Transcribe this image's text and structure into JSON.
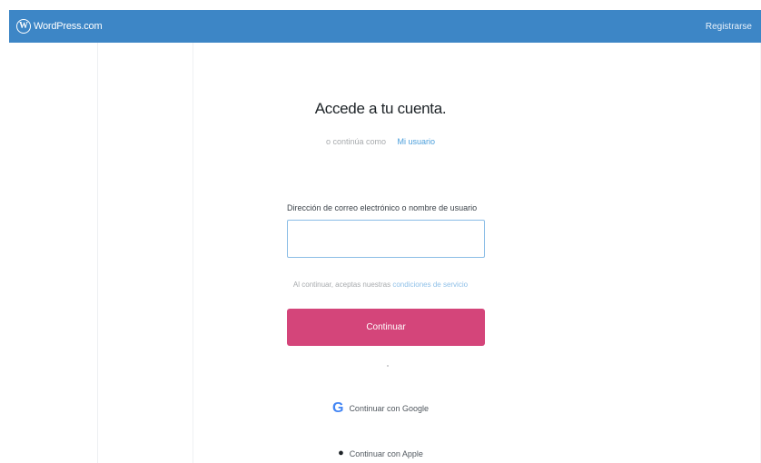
{
  "header": {
    "brand": "WordPress.com",
    "logo_letter": "W",
    "signup_link": "Registrarse"
  },
  "login": {
    "title": "Accede a tu cuenta.",
    "continue_as_prefix": "o continúa como",
    "continue_as_user": "Mi usuario",
    "email_label": "Dirección de correo electrónico o nombre de usuario",
    "email_value": "",
    "tos_prefix": "Al continuar, aceptas nuestras",
    "tos_link": "condiciones de servicio",
    "continue_button": "Continuar",
    "google_button": "Continuar con Google",
    "apple_button": "Continuar con Apple",
    "google_icon_glyph": "G",
    "apple_icon_glyph": "●"
  },
  "colors": {
    "masthead": "#3d86c6",
    "primary_button": "#d4457a",
    "link": "#4a9edb"
  },
  "icons": [
    "wordpress-logo-icon",
    "google-icon",
    "apple-icon"
  ]
}
